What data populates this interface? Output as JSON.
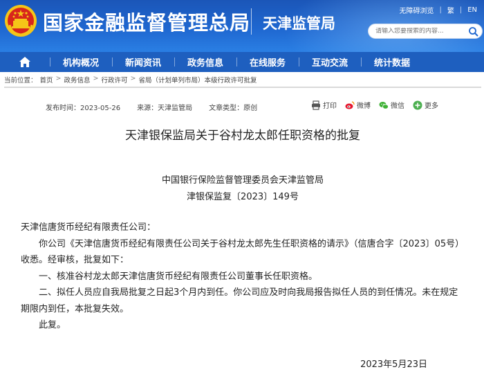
{
  "header": {
    "site_title": "国家金融监督管理总局",
    "sub_title": "天津监管局",
    "util_link_accessible": "无障碍浏览",
    "util_link_trad": "繁",
    "util_link_en": "EN",
    "search_placeholder": "请输入您要搜索的内容..."
  },
  "nav": {
    "items": [
      {
        "label": "机构概况"
      },
      {
        "label": "新闻资讯"
      },
      {
        "label": "政务信息"
      },
      {
        "label": "在线服务"
      },
      {
        "label": "互动交流"
      },
      {
        "label": "统计数据"
      }
    ]
  },
  "breadcrumb": {
    "prefix": "当前位置：",
    "items": [
      "首页",
      "政务信息",
      "行政许可",
      "省局（计划单列市局）本级行政许可批复"
    ]
  },
  "article": {
    "publish_label": "发布时间：2023-05-26",
    "source_label": "来源：天津监管局",
    "type_label": "文章类型：原创",
    "share": {
      "print": "打印",
      "weibo": "微博",
      "wechat": "微信",
      "more": "更多"
    },
    "title": "天津银保监局关于谷村龙太郎任职资格的批复",
    "issuer": "中国银行保险监督管理委员会天津监管局",
    "doc_number": "津银保监复〔2023〕149号",
    "addressee": "天津信唐货币经纪有限责任公司：",
    "para1": "你公司《天津信唐货币经纪有限责任公司关于谷村龙太郎先生任职资格的请示》（信唐合字〔2023〕05号）收悉。经审核，批复如下：",
    "para2": "一、核准谷村龙太郎天津信唐货币经纪有限责任公司董事长任职资格。",
    "para3": "二、拟任人员应自我局批复之日起3个月内到任。你公司应及时向我局报告拟任人员的到任情况。未在规定期限内到任，本批复失效。",
    "closing": "此复。",
    "date": "2023年5月23日"
  },
  "colors": {
    "header_blue": "#1f67d0",
    "nav_blue": "#1e5fbf",
    "emblem_red": "#d8251c",
    "emblem_gold": "#f5c518"
  }
}
